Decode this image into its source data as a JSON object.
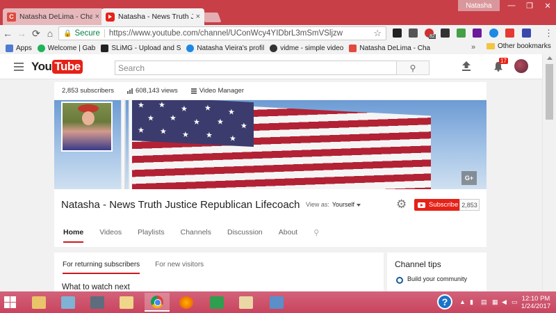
{
  "browser": {
    "tabs": [
      {
        "title": "Natasha DeLima - Chang",
        "icon": "c-favicon"
      },
      {
        "title": "Natasha - News Truth Ju",
        "icon": "youtube-favicon"
      }
    ],
    "close_glyph": "×",
    "profile_name": "Natasha",
    "window_controls": {
      "minimize": "—",
      "maximize": "❐",
      "close": "✕"
    },
    "nav": {
      "back": "←",
      "forward": "→",
      "reload": "⟳",
      "home": "⌂"
    },
    "omnibox": {
      "secure_label": "Secure",
      "url": "https://www.youtube.com/channel/UConWcy4YIDbrL3mSmVSljzw",
      "star": "☆",
      "lock": "🔒"
    },
    "extension_badge": "82"
  },
  "bookmarks": {
    "items": [
      {
        "label": "Apps",
        "color": "#4f7bd1"
      },
      {
        "label": "Welcome | Gab",
        "color": "#21b35a"
      },
      {
        "label": "SLiMG - Upload and S",
        "color": "#222222"
      },
      {
        "label": "Natasha Vieira's profil",
        "color": "#1e88e5"
      },
      {
        "label": "vidme - simple video",
        "color": "#333333"
      },
      {
        "label": "Natasha DeLima - Cha",
        "color": "#e04a3f"
      }
    ],
    "more": "»",
    "other_label": "Other bookmarks"
  },
  "youtube": {
    "logo_you": "You",
    "logo_tube": "Tube",
    "search_placeholder": "Search",
    "search_icon": "⚲",
    "notifications_count": "17"
  },
  "channel": {
    "stats": {
      "subscribers": "2,853 subscribers",
      "views": "608,143 views",
      "video_manager": "Video Manager"
    },
    "gplus_label": "G+",
    "title": "Natasha - News Truth Justice Republican Lifecoach",
    "view_as_label": "View as:",
    "view_as_value": "Yourself",
    "gear": "⚙",
    "subscribe_label": "Subscribe",
    "subscribe_count": "2,853",
    "tabs": [
      "Home",
      "Videos",
      "Playlists",
      "Channels",
      "Discussion",
      "About"
    ],
    "selected_tab": "Home",
    "tab_search": "⚲",
    "feed": {
      "subtabs": [
        "For returning subscribers",
        "For new visitors"
      ],
      "section_title": "What to watch next"
    },
    "tips": {
      "title": "Channel tips",
      "item": "Build your community"
    }
  },
  "taskbar": {
    "help": "?",
    "clock_time": "12:10 PM",
    "clock_date": "1/24/2017"
  },
  "colors": {
    "accent_red": "#e62117",
    "tab_strip": "#c83f48",
    "taskbar": "#c9435e"
  }
}
